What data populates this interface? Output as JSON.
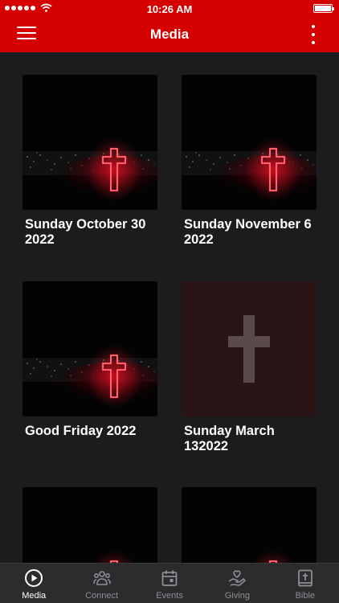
{
  "status_bar": {
    "time": "10:26 AM"
  },
  "header": {
    "title": "Media"
  },
  "media_items": [
    {
      "title": "Sunday October 30 2022"
    },
    {
      "title": "Sunday November 6 2022"
    },
    {
      "title": "Good Friday 2022"
    },
    {
      "title": "Sunday March 132022"
    }
  ],
  "tabs": [
    {
      "label": "Media",
      "icon": "play-circle-icon",
      "active": true
    },
    {
      "label": "Connect",
      "icon": "people-icon",
      "active": false
    },
    {
      "label": "Events",
      "icon": "calendar-icon",
      "active": false
    },
    {
      "label": "Giving",
      "icon": "heart-hand-icon",
      "active": false
    },
    {
      "label": "Bible",
      "icon": "bible-icon",
      "active": false
    }
  ],
  "colors": {
    "brand": "#d50000",
    "background": "#1c1c1e",
    "tab_bar": "#2c2c2e",
    "neon_cross": "#ff2a3a"
  }
}
